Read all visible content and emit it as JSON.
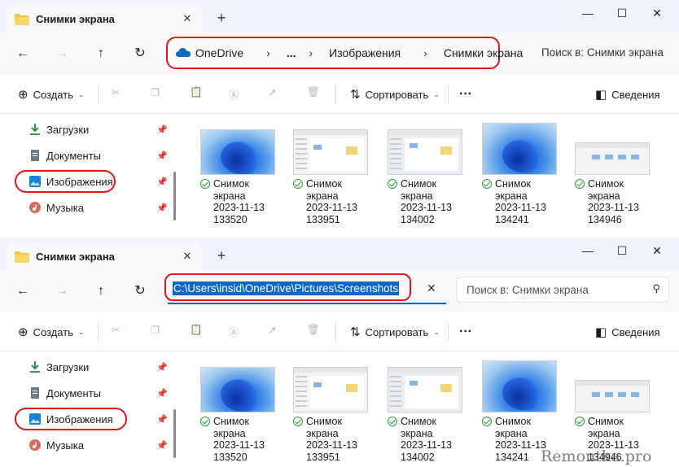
{
  "top": {
    "tab_title": "Снимки экрана",
    "breadcrumb": [
      "OneDrive",
      "...",
      "Изображения",
      "Снимки экрана"
    ],
    "search_placeholder": "Поиск в: Снимки экрана"
  },
  "bottom": {
    "tab_title": "Снимки экрана",
    "path_text": "C:\\Users\\insid\\OneDrive\\Pictures\\Screenshots",
    "search_placeholder": "Поиск в: Снимки экрана"
  },
  "toolbar": {
    "create": "Создать",
    "sort": "Сортировать",
    "more": "···",
    "details": "Сведения"
  },
  "sidebar": {
    "items": [
      "Загрузки",
      "Документы",
      "Изображения",
      "Музыка"
    ],
    "highlighted": "Изображения"
  },
  "files": [
    {
      "line1": "Снимок",
      "line2": "экрана",
      "date": "2023-11-13",
      "time": "133520",
      "thumb": "wallpaper"
    },
    {
      "line1": "Снимок",
      "line2": "экрана",
      "date": "2023-11-13",
      "time": "133951",
      "thumb": "window"
    },
    {
      "line1": "Снимок",
      "line2": "экрана",
      "date": "2023-11-13",
      "time": "134002",
      "thumb": "window"
    },
    {
      "line1": "Снимок",
      "line2": "экрана",
      "date": "2023-11-13",
      "time": "134241",
      "thumb": "wallpaper"
    },
    {
      "line1": "Снимок",
      "line2": "экрана",
      "date": "2023-11-13",
      "time": "134946",
      "thumb": "window"
    }
  ],
  "colors": {
    "highlight_ring": "#e0161b",
    "selection": "#0f68c9",
    "sync_ok": "#2a9a3a"
  },
  "watermark": "Remontka.pro"
}
